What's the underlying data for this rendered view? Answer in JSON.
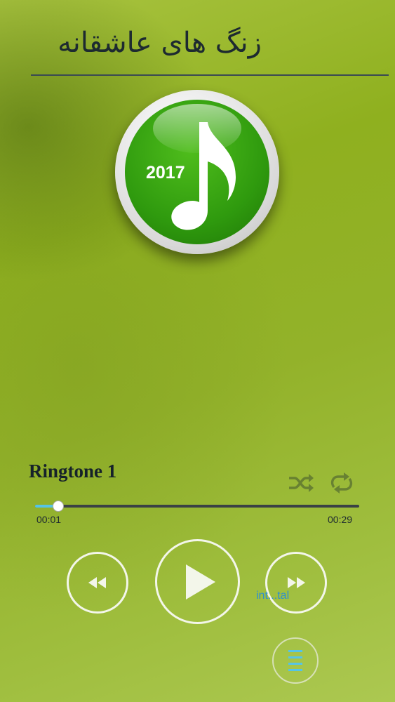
{
  "header": {
    "title": "زنگ های عاشقانه"
  },
  "logo": {
    "year": "2017"
  },
  "player": {
    "track_name": "Ringtone 1",
    "elapsed": "00:01",
    "duration": "00:29",
    "progress": 0.07,
    "ad_label": "int...tal"
  },
  "icons": {
    "shuffle": "shuffle-icon",
    "repeat": "repeat-icon",
    "rewind": "rewind-icon",
    "play": "play-icon",
    "fast_forward": "fast-forward-icon",
    "menu": "menu-icon",
    "music_note": "music-note-icon"
  },
  "colors": {
    "progress_fill": "#55c4e6",
    "menu_icon": "#55c4e6",
    "ad_text": "#2e8fd0"
  }
}
